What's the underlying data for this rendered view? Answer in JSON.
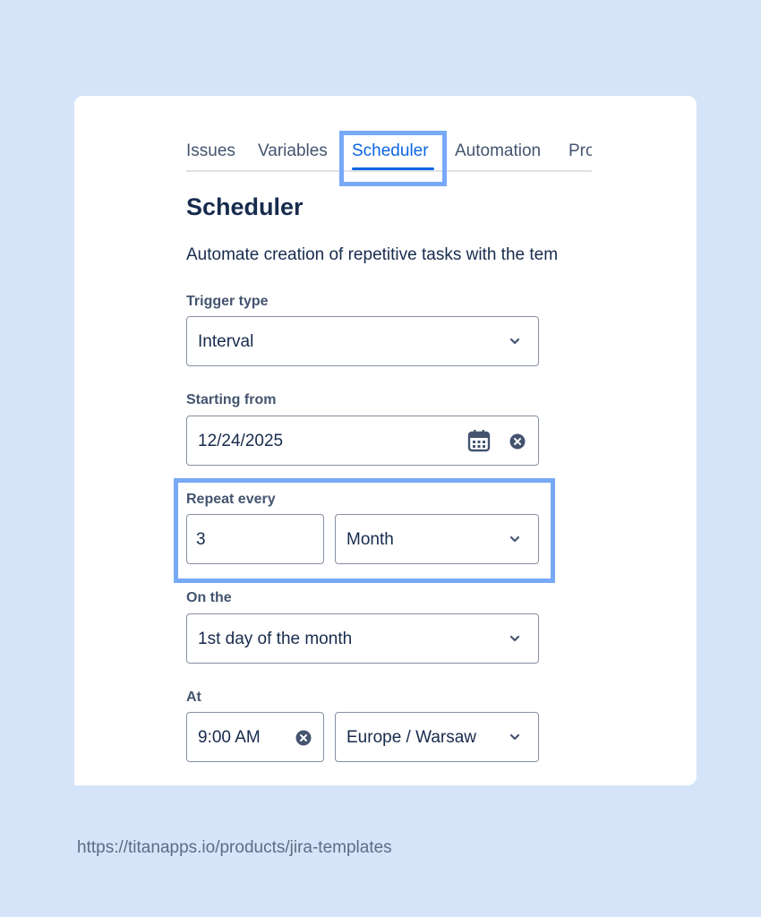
{
  "tabs": [
    {
      "label": "Issues"
    },
    {
      "label": "Variables"
    },
    {
      "label": "Scheduler"
    },
    {
      "label": "Automation"
    },
    {
      "label": "Pro"
    }
  ],
  "active_tab": "Scheduler",
  "page": {
    "title": "Scheduler",
    "description": "Automate creation of repetitive tasks with the tem"
  },
  "form": {
    "trigger_type": {
      "label": "Trigger type",
      "value": "Interval"
    },
    "starting_from": {
      "label": "Starting from",
      "value": "12/24/2025"
    },
    "repeat_every": {
      "label": "Repeat every",
      "count": "3",
      "unit": "Month"
    },
    "on_the": {
      "label": "On the",
      "value": "1st day of the month"
    },
    "at": {
      "label": "At",
      "time": "9:00 AM",
      "timezone": "Europe / Warsaw"
    }
  },
  "footer": {
    "url": "https://titanapps.io/products/jira-templates"
  },
  "colors": {
    "background": "#d6e4f9",
    "accent": "#0c66e4",
    "highlight": "#78a9f7",
    "text": "#172b4d"
  },
  "icons": [
    "chevron-down-icon",
    "calendar-icon",
    "clear-icon"
  ]
}
